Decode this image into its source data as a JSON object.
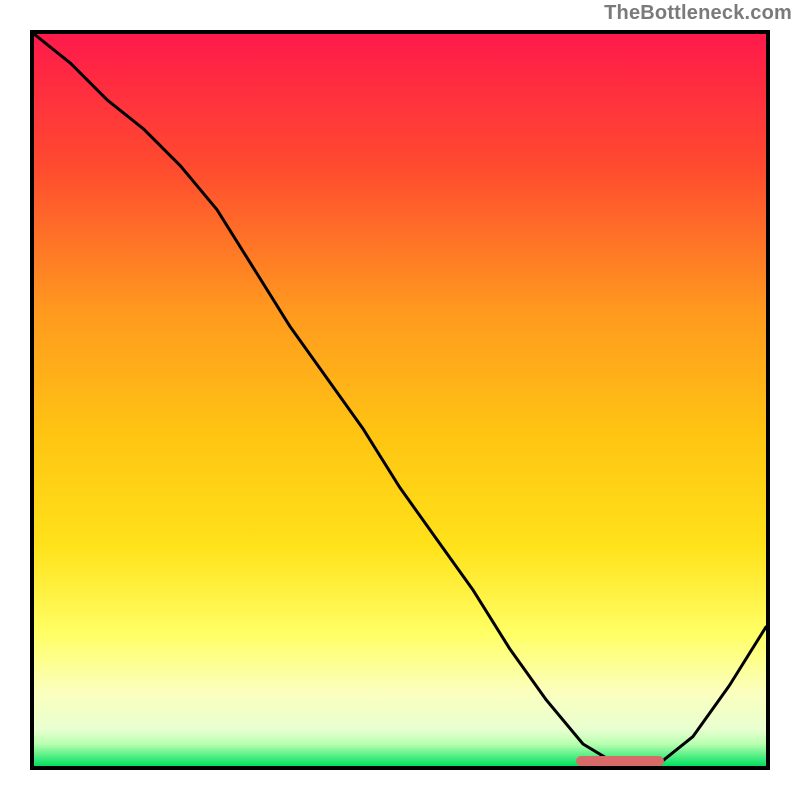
{
  "watermark": "TheBottleneck.com",
  "colors": {
    "top": "#ff1a4b",
    "mid_upper": "#ff9a1f",
    "mid": "#ffd400",
    "mid_lower": "#ffff66",
    "near_bottom": "#f7ffc2",
    "green": "#00e060",
    "axis": "#000000",
    "curve": "#000000",
    "marker": "#d96a6a"
  },
  "chart_data": {
    "type": "line",
    "title": "",
    "xlabel": "",
    "ylabel": "",
    "xlim": [
      0,
      100
    ],
    "ylim": [
      0,
      100
    ],
    "series": [
      {
        "name": "curve",
        "x": [
          0,
          5,
          10,
          15,
          20,
          25,
          30,
          35,
          40,
          45,
          50,
          55,
          60,
          65,
          70,
          75,
          80,
          85,
          90,
          95,
          100
        ],
        "y": [
          100,
          96,
          91,
          87,
          82,
          76,
          68,
          60,
          53,
          46,
          38,
          31,
          24,
          16,
          9,
          3,
          0,
          0,
          4,
          11,
          19
        ]
      }
    ],
    "marker_segment": {
      "x_start": 74,
      "x_end": 86,
      "y": 0
    }
  }
}
